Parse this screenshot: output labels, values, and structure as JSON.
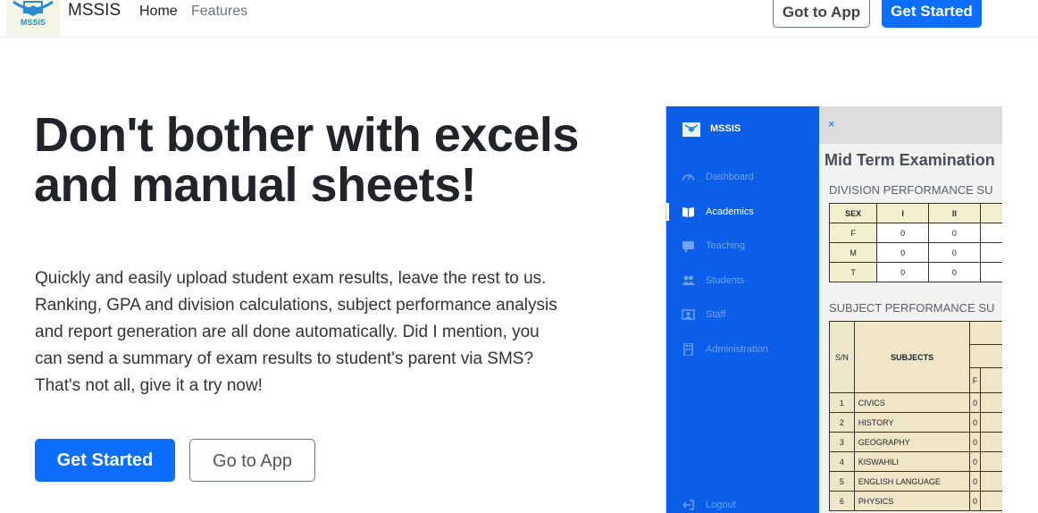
{
  "navbar": {
    "logo_text": "MSSIS",
    "brand": "MSSIS",
    "links": [
      "Home",
      "Features"
    ],
    "goto_app_label": "Got to App",
    "get_started_label": "Get Started"
  },
  "hero": {
    "title": "Don't bother with excels and manual sheets!",
    "paragraph": "Quickly and easily upload student exam results, leave the rest to us. Ranking, GPA and division calculations, subject performance analysis and report generation are all done automatically. Did I mention, you can send a summary of exam results to student's parent via SMS?",
    "tagline": "That's not all, give it a try now!",
    "get_started_label": "Get Started",
    "goto_app_label": "Go to App"
  },
  "mockup": {
    "brand": "MSSIS",
    "close_glyph": "×",
    "sidebar": [
      {
        "label": "Dashboard",
        "icon": "gauge-icon"
      },
      {
        "label": "Academics",
        "icon": "book-icon"
      },
      {
        "label": "Teaching",
        "icon": "chalkboard-icon"
      },
      {
        "label": "Students",
        "icon": "users-icon"
      },
      {
        "label": "Staff",
        "icon": "id-card-icon"
      },
      {
        "label": "Administration",
        "icon": "building-icon"
      }
    ],
    "active_item": "Academics",
    "logout_label": "Logout",
    "title": "Mid Term Examination",
    "division_heading": "DIVISION PERFORMANCE SU",
    "division_table": {
      "headers": [
        "SEX",
        "I",
        "II"
      ],
      "rows": [
        [
          "F",
          "0",
          "0"
        ],
        [
          "M",
          "0",
          "0"
        ],
        [
          "T",
          "0",
          "0"
        ]
      ]
    },
    "subject_heading": "SUBJECT PERFORMANCE SU",
    "subject_table": {
      "headers": [
        "S/N",
        "SUBJECTS",
        "F"
      ],
      "rows": [
        [
          "1",
          "CIVICS",
          "0"
        ],
        [
          "2",
          "HISTORY",
          "0"
        ],
        [
          "3",
          "GEOGRAPHY",
          "0"
        ],
        [
          "4",
          "KISWAHILI",
          "0"
        ],
        [
          "5",
          "ENGLISH LANGUAGE",
          "0"
        ],
        [
          "6",
          "PHYSICS",
          "0"
        ]
      ]
    }
  },
  "colors": {
    "primary": "#0d6efd",
    "sidebar": "#0a5ee8",
    "table_header": "#f6efcf"
  }
}
